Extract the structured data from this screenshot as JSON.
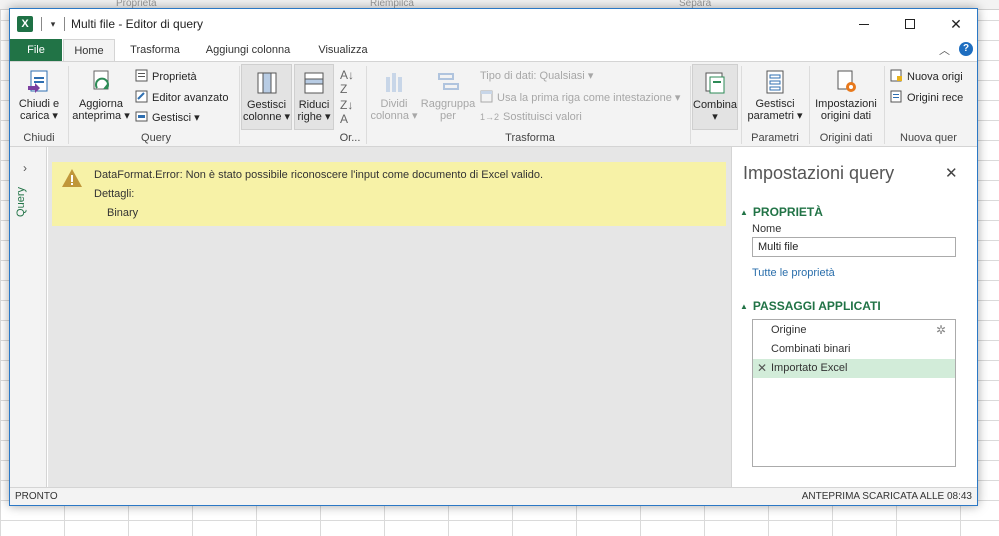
{
  "window": {
    "title": "Multi file - Editor di query",
    "app_icon": "X"
  },
  "tabs": [
    {
      "label": "File"
    },
    {
      "label": "Home"
    },
    {
      "label": "Trasforma"
    },
    {
      "label": "Aggiungi colonna"
    },
    {
      "label": "Visualizza"
    }
  ],
  "ribbon": {
    "chiudi": {
      "btn1": "Chiudi e",
      "btn2": "carica",
      "group": "Chiudi"
    },
    "query": {
      "aggiorna1": "Aggiorna",
      "aggiorna2": "anteprima",
      "proprieta": "Proprietà",
      "editor": "Editor avanzato",
      "gestisci": "Gestisci",
      "group": "Query"
    },
    "colonne": {
      "b1": "Gestisci",
      "b2": "colonne"
    },
    "righe": {
      "b1": "Riduci",
      "b2": "righe"
    },
    "ordina": {
      "group": "Or..."
    },
    "trasforma": {
      "dividi1": "Dividi",
      "dividi2": "colonna",
      "raggruppa1": "Raggruppa",
      "raggruppa2": "per",
      "tipo": "Tipo di dati: Qualsiasi",
      "prima_riga": "Usa la prima riga come intestazione",
      "sostituisci": "Sostituisci valori",
      "group": "Trasforma"
    },
    "combina": {
      "b1": "Combina"
    },
    "parametri": {
      "b1": "Gestisci",
      "b2": "parametri",
      "group": "Parametri"
    },
    "origini": {
      "b1": "Impostazioni",
      "b2": "origini dati",
      "group": "Origini dati"
    },
    "nuova": {
      "b1": "Nuova origi",
      "b2": "Origini rece",
      "group": "Nuova quer"
    }
  },
  "side": {
    "label": "Query"
  },
  "error": {
    "message": "DataFormat.Error: Non è stato possibile riconoscere l'input come documento di Excel valido.",
    "details_label": "Dettagli:",
    "details_value": "Binary"
  },
  "pane": {
    "title": "Impostazioni query",
    "properties_header": "PROPRIETÀ",
    "name_label": "Nome",
    "name_value": "Multi file",
    "all_properties": "Tutte le proprietà",
    "steps_header": "PASSAGGI APPLICATI",
    "steps": [
      {
        "label": "Origine"
      },
      {
        "label": "Combinati binari"
      },
      {
        "label": "Importato Excel"
      }
    ]
  },
  "status": {
    "left": "PRONTO",
    "right": "ANTEPRIMA SCARICATA ALLE 08:43"
  },
  "background": {
    "label1": "Proprietà",
    "label2": "Riempilca",
    "label3": "Separa"
  },
  "colors": {
    "accent": "#217346",
    "error_bg": "#f7f2a7",
    "selected_step": "#d2ecd9",
    "link": "#2a6eab"
  }
}
